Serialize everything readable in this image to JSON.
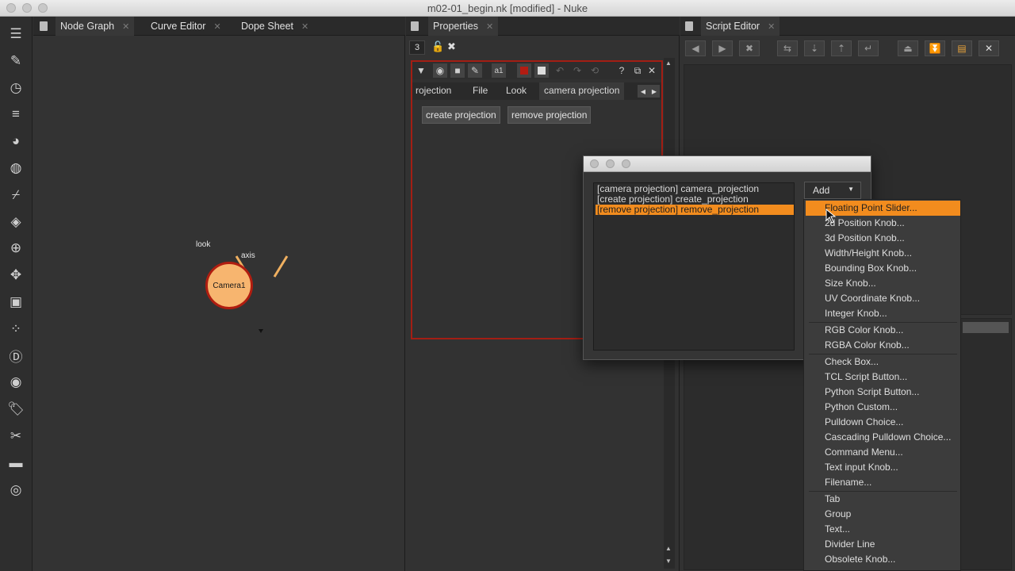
{
  "window": {
    "title": "m02-01_begin.nk [modified] - Nuke"
  },
  "toolbar": {
    "icons": [
      "panels-icon",
      "paint-brush-icon",
      "clock-icon",
      "layers-stack-icon",
      "color-wheel-icon",
      "channel-icon",
      "filter-icon",
      "keyer-icon",
      "merge-icon",
      "transform-icon",
      "3d-cube-icon",
      "particles-icon",
      "deep-icon",
      "views-icon",
      "metadata-icon",
      "toolsets-icon",
      "other-icon",
      "furnace-icon"
    ]
  },
  "node_graph": {
    "tabs": [
      {
        "label": "Node Graph"
      },
      {
        "label": "Curve Editor"
      },
      {
        "label": "Dope Sheet"
      }
    ],
    "node": {
      "label": "Camera1",
      "input_look": "look",
      "input_axis": "axis"
    }
  },
  "properties": {
    "tab_label": "Properties",
    "max_panels": "3",
    "panel_tabs": [
      {
        "label": "rojection"
      },
      {
        "label": "File"
      },
      {
        "label": "Look"
      },
      {
        "label": "camera projection"
      }
    ],
    "buttons": {
      "create": "create projection",
      "remove": "remove projection"
    },
    "mini_label": "a1"
  },
  "script_editor": {
    "tab_label": "Script Editor"
  },
  "dialog": {
    "knobs": [
      "[camera projection] camera_projection",
      "[create projection] create_projection",
      "[remove projection] remove_projection"
    ],
    "selected_index": 2,
    "add_label": "Add"
  },
  "add_menu": {
    "groups": [
      [
        "Floating Point Slider...",
        "2d Position Knob...",
        "3d Position Knob...",
        "Width/Height Knob...",
        "Bounding Box Knob...",
        "Size Knob...",
        "UV Coordinate Knob...",
        "Integer Knob..."
      ],
      [
        "RGB Color Knob...",
        "RGBA Color Knob..."
      ],
      [
        "Check Box...",
        "TCL Script Button...",
        "Python Script Button...",
        "Python Custom...",
        "Pulldown Choice...",
        "Cascading Pulldown Choice...",
        "Command Menu...",
        "Text input Knob...",
        "Filename..."
      ],
      [
        "Tab",
        "Group",
        "Text...",
        "Divider Line",
        "Obsolete Knob..."
      ]
    ],
    "highlighted": "Floating Point Slider..."
  },
  "colors": {
    "accent_orange": "#f28c1e",
    "node_fill": "#f7b56f",
    "node_border": "#b01d10",
    "panel_border": "#a31e14"
  }
}
